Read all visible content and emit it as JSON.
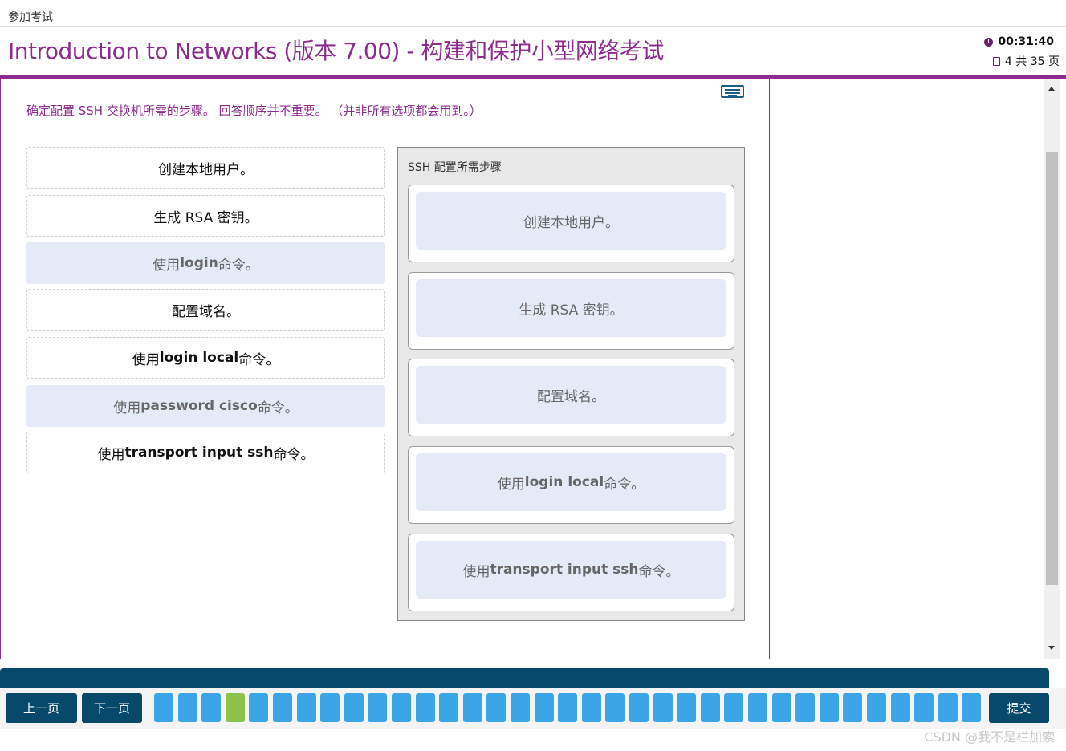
{
  "breadcrumb": "参加考试",
  "header": {
    "title": "Introduction to Networks (版本 7.00) - 构建和保护小型网络考试",
    "timer": "00:31:40",
    "pages": "4 共 35 页"
  },
  "question": {
    "instruction": "确定配置 SSH 交换机所需的步骤。 回答顺序并不重要。 （并非所有选项都会用到。）"
  },
  "options": [
    {
      "pre": "创建本地用户。",
      "bold": "",
      "post": "",
      "used": true
    },
    {
      "pre": "生成 RSA 密钥。",
      "bold": "",
      "post": "",
      "used": true
    },
    {
      "pre": "使用 ",
      "bold": "login",
      "post": " 命令。",
      "used": false
    },
    {
      "pre": "配置域名。",
      "bold": "",
      "post": "",
      "used": true
    },
    {
      "pre": "使用 ",
      "bold": "login local",
      "post": " 命令。",
      "used": true
    },
    {
      "pre": "使用 ",
      "bold": "password cisco",
      "post": " 命令。",
      "used": false
    },
    {
      "pre": "使用 ",
      "bold": "transport input ssh",
      "post": " 命令。",
      "used": true
    }
  ],
  "target": {
    "caption": "SSH 配置所需步骤",
    "slots": [
      {
        "pre": "创建本地用户。",
        "bold": "",
        "post": ""
      },
      {
        "pre": "生成 RSA 密钥。",
        "bold": "",
        "post": ""
      },
      {
        "pre": "配置域名。",
        "bold": "",
        "post": ""
      },
      {
        "pre": "使用 ",
        "bold": "login local",
        "post": " 命令。"
      },
      {
        "pre": "使用 ",
        "bold": "transport input ssh",
        "post": " 命令。"
      }
    ]
  },
  "nav": {
    "prev": "上一页",
    "next": "下一页",
    "submit": "提交",
    "question_count": 35,
    "current_question": 4
  },
  "watermark": "CSDN @我不是栏加索",
  "colors": {
    "accent": "#8e2b8f",
    "nav": "#06496b",
    "question_button": "#3aa6e8",
    "current_question": "#8bc34a",
    "placed_item": "#e4ebf7"
  }
}
